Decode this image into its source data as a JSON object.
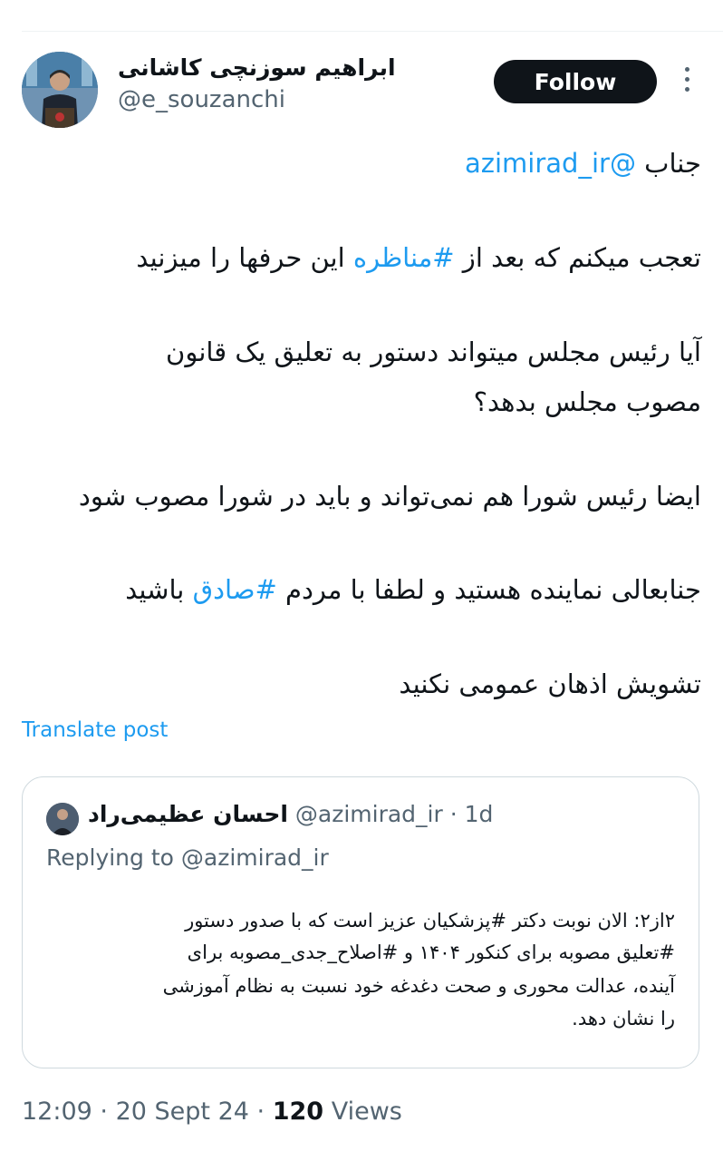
{
  "author": {
    "display_name": "ابراهیم سوزنچی کاشانی",
    "handle": "@e_souzanchi"
  },
  "actions": {
    "follow_label": "Follow"
  },
  "tweet": {
    "line1_prefix": "جناب ",
    "line1_mention": "@azimirad_ir",
    "line2_a": "تعجب میکنم که بعد از ",
    "line2_tag": "#مناظره",
    "line2_b": " این حرفها را میزنید",
    "line3": "آیا رئیس مجلس میتواند دستور به تعلیق یک قانون",
    "line4": "مصوب مجلس بدهد؟",
    "line5": "ایضا رئیس شورا هم نمی‌تواند و باید در شورا مصوب شود",
    "line6_a": "جنابعالی نماینده هستید و لطفا با مردم ",
    "line6_tag": "#صادق",
    "line6_b": " باشید",
    "line7": "تشویش اذهان عمومی نکنید"
  },
  "translate_label": "Translate post",
  "quoted": {
    "display_name": "احسان عظیمی‌راد",
    "handle": "@azimirad_ir",
    "separator": "·",
    "time": "1d",
    "replying_label": "Replying to ",
    "replying_handle": "@azimirad_ir",
    "lines": [
      "۲از۲: الان نوبت دکتر #پزشکیان عزیز است که با صدور دستور",
      "#تعلیق مصوبه برای کنکور ۱۴۰۴ و #اصلاح_جدی_مصوبه برای",
      "آینده، عدالت محوری و صحت دغدغه خود نسبت به نظام آموزشی",
      "را نشان دهد."
    ]
  },
  "meta": {
    "time": "12:09",
    "separator": "·",
    "date": "20 Sept 24",
    "views_count": "120",
    "views_label": "Views"
  },
  "colors": {
    "accent": "#1d9bf0",
    "text": "#0f1419",
    "muted": "#536471",
    "border": "#cfd9de"
  }
}
